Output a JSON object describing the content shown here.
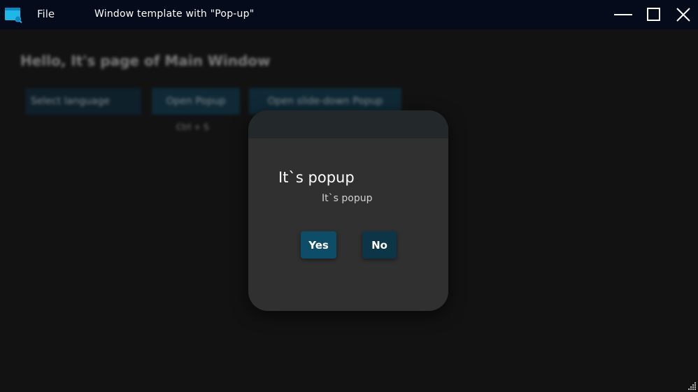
{
  "titlebar": {
    "menu_file": "File",
    "window_title": "Window template with \"Pop-up\"",
    "app_icon": "window-app-icon",
    "controls": [
      "minimize-icon",
      "maximize-icon",
      "close-icon"
    ]
  },
  "main": {
    "heading": "Hello, It's page of Main Window",
    "language_select": "Select language",
    "open_popup_label": "Open Popup",
    "open_slide_label": "Open slide-down Popup",
    "shortcut_hint": "Ctrl + S"
  },
  "popup": {
    "title": "It`s popup",
    "message": "It`s popup",
    "yes_label": "Yes",
    "no_label": "No"
  },
  "colors": {
    "titlebar_bg": "#060b1c",
    "window_bg": "#121212",
    "popup_bg": "#303030",
    "popup_header_bg": "#23282a",
    "accent_button": "#0d4d68",
    "accent_button_dark": "#0c3547"
  }
}
